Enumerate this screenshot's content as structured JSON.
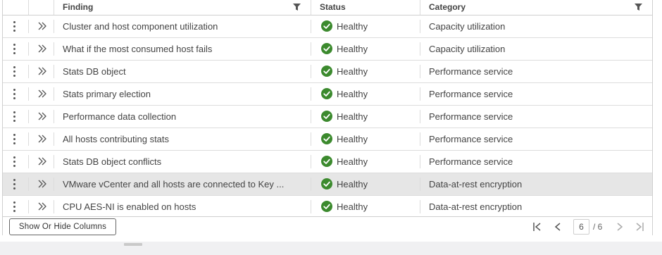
{
  "columns": {
    "finding": "Finding",
    "status": "Status",
    "category": "Category"
  },
  "rows": [
    {
      "finding": "Cluster and host component utilization",
      "status": "Healthy",
      "category": "Capacity utilization"
    },
    {
      "finding": "What if the most consumed host fails",
      "status": "Healthy",
      "category": "Capacity utilization"
    },
    {
      "finding": "Stats DB object",
      "status": "Healthy",
      "category": "Performance service"
    },
    {
      "finding": "Stats primary election",
      "status": "Healthy",
      "category": "Performance service"
    },
    {
      "finding": "Performance data collection",
      "status": "Healthy",
      "category": "Performance service"
    },
    {
      "finding": "All hosts contributing stats",
      "status": "Healthy",
      "category": "Performance service"
    },
    {
      "finding": "Stats DB object conflicts",
      "status": "Healthy",
      "category": "Performance service"
    },
    {
      "finding": "VMware vCenter and all hosts are connected to Key ...",
      "status": "Healthy",
      "category": "Data-at-rest encryption"
    },
    {
      "finding": "CPU AES-NI is enabled on hosts",
      "status": "Healthy",
      "category": "Data-at-rest encryption"
    }
  ],
  "selected_row": 7,
  "footer": {
    "toggle_columns_label": "Show Or Hide Columns",
    "page_current": "6",
    "page_total": "/ 6"
  },
  "colors": {
    "healthy": "#3c8a2e",
    "selected_row_bg": "#e6e6e6"
  },
  "icons": {
    "row_menu": "kebab-icon",
    "row_expand": "double-chevron-right-icon",
    "status_ok": "check-circle-icon",
    "filter": "filter-icon",
    "first_page": "first-page-icon",
    "prev_page": "prev-page-icon",
    "next_page": "next-page-icon",
    "last_page": "last-page-icon"
  }
}
